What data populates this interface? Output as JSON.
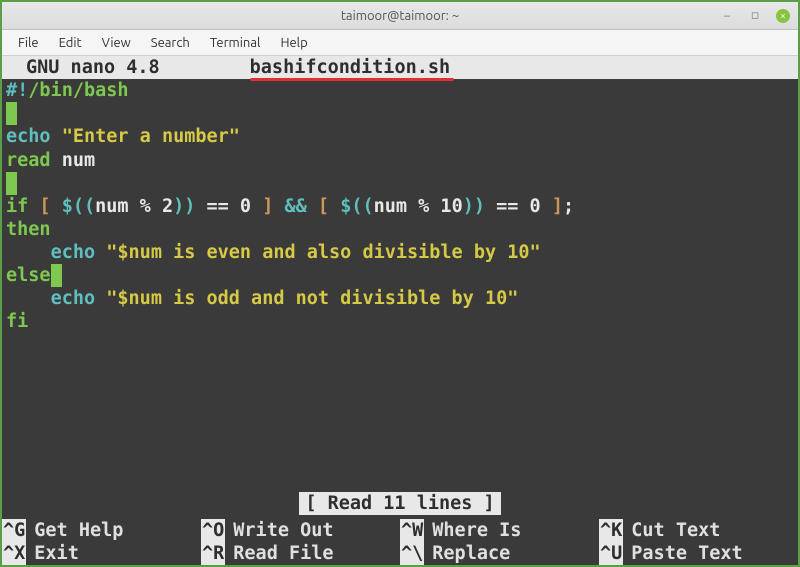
{
  "window": {
    "title": "taimoor@taimoor: ~"
  },
  "menubar": {
    "items": [
      "File",
      "Edit",
      "View",
      "Search",
      "Terminal",
      "Help"
    ]
  },
  "nano": {
    "header_name": "GNU nano 4.8",
    "filename": "bashifcondition.sh",
    "status_line": "[ Read 11 lines ]"
  },
  "code": {
    "l1_shebang_prefix": "#!",
    "l1_shebang_rest": "/bin/bash",
    "l3_echo": "echo",
    "l3_str": "\"Enter a number\"",
    "l4_read": "read",
    "l4_var": "num",
    "l6_if": "if",
    "l6_lbracket": " [ ",
    "l6_expr1a": "$((",
    "l6_expr1b": "num % 2",
    "l6_expr1c": "))",
    "l6_eq": " == 0 ",
    "l6_rbracket": "]",
    "l6_and": " && ",
    "l6_expr2a": "$((",
    "l6_expr2b": "num % 10",
    "l6_expr2c": "))",
    "l6_tail": ";",
    "l7_then": "then",
    "l8_echo": "echo",
    "l8_str": "\"$num is even and also divisible by 10\"",
    "l9_else": "else",
    "l10_echo": "echo",
    "l10_str": "\"$num is odd and not divisible by 10\"",
    "l11_fi": "fi"
  },
  "shortcuts": {
    "row1": [
      {
        "key": "^G",
        "label": "Get Help"
      },
      {
        "key": "^O",
        "label": "Write Out"
      },
      {
        "key": "^W",
        "label": "Where Is"
      },
      {
        "key": "^K",
        "label": "Cut Text"
      }
    ],
    "row2": [
      {
        "key": "^X",
        "label": "Exit"
      },
      {
        "key": "^R",
        "label": "Read File"
      },
      {
        "key": "^\\",
        "label": "Replace"
      },
      {
        "key": "^U",
        "label": "Paste Text"
      }
    ]
  }
}
